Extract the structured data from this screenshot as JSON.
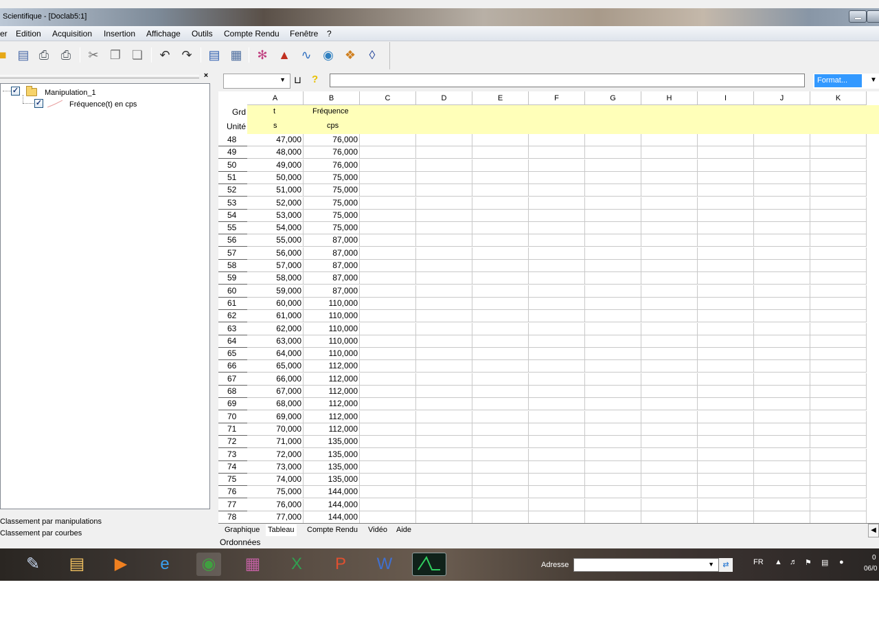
{
  "window": {
    "title": "Scientifique - [Doclab5:1]"
  },
  "menu": [
    "er",
    "Edition",
    "Acquisition",
    "Insertion",
    "Affichage",
    "Outils",
    "Compte Rendu",
    "Fenêtre",
    "?"
  ],
  "tree": {
    "root": "Manipulation_1",
    "child": "Fréquence(t) en cps"
  },
  "sort_options": [
    "Classement par manipulations",
    "Classement par courbes"
  ],
  "formula_bar": {
    "format": "Format..."
  },
  "grid": {
    "columns": [
      "A",
      "B",
      "C",
      "D",
      "E",
      "F",
      "G",
      "H",
      "I",
      "J",
      "K"
    ],
    "grd_label": "Grd",
    "unit_label": "Unité",
    "names": [
      "t",
      "Fréquence"
    ],
    "units": [
      "s",
      "cps"
    ],
    "rows": [
      [
        "48",
        "47,000",
        "76,000"
      ],
      [
        "49",
        "48,000",
        "76,000"
      ],
      [
        "50",
        "49,000",
        "76,000"
      ],
      [
        "51",
        "50,000",
        "75,000"
      ],
      [
        "52",
        "51,000",
        "75,000"
      ],
      [
        "53",
        "52,000",
        "75,000"
      ],
      [
        "54",
        "53,000",
        "75,000"
      ],
      [
        "55",
        "54,000",
        "75,000"
      ],
      [
        "56",
        "55,000",
        "87,000"
      ],
      [
        "57",
        "56,000",
        "87,000"
      ],
      [
        "58",
        "57,000",
        "87,000"
      ],
      [
        "59",
        "58,000",
        "87,000"
      ],
      [
        "60",
        "59,000",
        "87,000"
      ],
      [
        "61",
        "60,000",
        "110,000"
      ],
      [
        "62",
        "61,000",
        "110,000"
      ],
      [
        "63",
        "62,000",
        "110,000"
      ],
      [
        "64",
        "63,000",
        "110,000"
      ],
      [
        "65",
        "64,000",
        "110,000"
      ],
      [
        "66",
        "65,000",
        "112,000"
      ],
      [
        "67",
        "66,000",
        "112,000"
      ],
      [
        "68",
        "67,000",
        "112,000"
      ],
      [
        "69",
        "68,000",
        "112,000"
      ],
      [
        "70",
        "69,000",
        "112,000"
      ],
      [
        "71",
        "70,000",
        "112,000"
      ],
      [
        "72",
        "71,000",
        "135,000"
      ],
      [
        "73",
        "72,000",
        "135,000"
      ],
      [
        "74",
        "73,000",
        "135,000"
      ],
      [
        "75",
        "74,000",
        "135,000"
      ],
      [
        "76",
        "75,000",
        "144,000"
      ],
      [
        "77",
        "76,000",
        "144,000"
      ],
      [
        "78",
        "77,000",
        "144,000"
      ]
    ]
  },
  "tabs": [
    "Graphique",
    "Tableau",
    "Compte Rendu",
    "Vidéo",
    "Aide"
  ],
  "active_tab": "Tableau",
  "status": "Ordonnées",
  "taskbar": {
    "address_label": "Adresse",
    "lang": "FR",
    "clock_time": "0",
    "clock_date": "06/0"
  },
  "icons": {
    "toolbar": [
      "open-folder-icon",
      "save-icon",
      "print-icon",
      "print-preview-icon",
      "cut-icon",
      "copy-icon",
      "paste-icon",
      "undo-icon",
      "redo-icon",
      "graph-window-icon",
      "table-window-icon",
      "modeling-icon",
      "acquisition-icon",
      "curve-icon",
      "disk-icon",
      "tools-icon",
      "report-icon"
    ],
    "taskbar": [
      "app-icon",
      "file-explorer-icon",
      "media-player-icon",
      "internet-explorer-icon",
      "chrome-icon",
      "winrar-icon",
      "excel-icon",
      "powerpoint-icon",
      "word-icon",
      "scientific-app-icon"
    ]
  },
  "colors": {
    "header_row_bg": "#ffffb9",
    "format_selection": "#3399ff"
  }
}
